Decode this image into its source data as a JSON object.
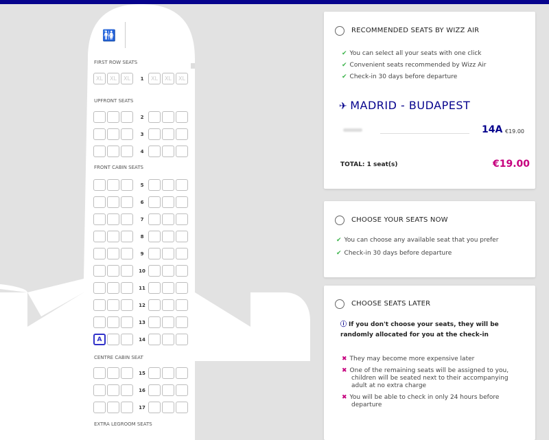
{
  "seatmap": {
    "sections": [
      "FIRST ROW SEATS",
      "UPFRONT SEATS",
      "FRONT CABIN SEATS",
      "CENTRE CABIN SEAT",
      "EXTRA LEGROOM SEATS"
    ],
    "seat_placeholder": "XL",
    "rows": [
      "1",
      "2",
      "3",
      "4",
      "5",
      "6",
      "7",
      "8",
      "9",
      "10",
      "11",
      "12",
      "13",
      "14",
      "15",
      "16",
      "17"
    ],
    "selected_seat_letter": "A",
    "selected_row": "14"
  },
  "recommended": {
    "title": "RECOMMENDED SEATS BY WIZZ AIR",
    "bullets": [
      "You can select all your seats with one click",
      "Convenient seats recommended by Wizz Air",
      "Check-in 30 days before departure"
    ],
    "route": "MADRID - BUDAPEST",
    "seat": "14A",
    "seat_price": "€19.00",
    "total_label": "TOTAL:  1 seat(s)",
    "total_value": "€19.00"
  },
  "now": {
    "title": "CHOOSE YOUR SEATS NOW",
    "bullets": [
      "You can choose any available seat that you prefer",
      "Check-in 30 days before departure"
    ]
  },
  "later": {
    "title": "CHOOSE SEATS LATER",
    "info": "If you don't choose your seats, they will be randomly allocated for you at the check-in",
    "bullets": [
      "They may become more expensive later",
      "One of the remaining seats will be assigned to you, children will be seated next to their accompanying adult at no extra charge",
      "You will be able to check in only 24 hours before departure"
    ]
  },
  "colors": {
    "brand": "#06038d",
    "accent": "#c6007e",
    "check": "#3cb44b"
  }
}
